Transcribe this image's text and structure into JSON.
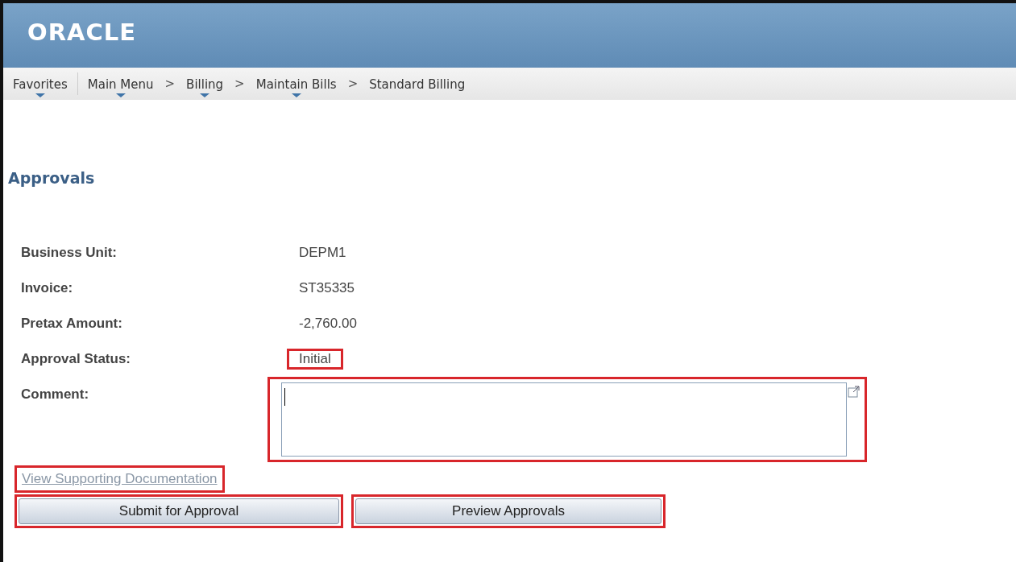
{
  "header": {
    "logo": "ORACLE"
  },
  "breadcrumbs": [
    {
      "kind": "link",
      "label": "Favorites",
      "menu": true
    },
    {
      "kind": "divider"
    },
    {
      "kind": "link",
      "label": "Main Menu",
      "menu": true
    },
    {
      "kind": "separator",
      "label": ">"
    },
    {
      "kind": "link",
      "label": "Billing",
      "menu": true
    },
    {
      "kind": "separator",
      "label": ">"
    },
    {
      "kind": "link",
      "label": "Maintain Bills",
      "menu": true
    },
    {
      "kind": "separator",
      "label": ">"
    },
    {
      "kind": "link",
      "label": "Standard Billing",
      "menu": false
    }
  ],
  "page_title": "Approvals",
  "fields": [
    {
      "label": "Business Unit:",
      "value": "DEPM1",
      "highlighted": false
    },
    {
      "label": "Invoice:",
      "value": "ST35335",
      "highlighted": false
    },
    {
      "label": "Pretax Amount:",
      "value": "-2,760.00",
      "highlighted": false
    },
    {
      "label": "Approval Status:",
      "value": "Initial",
      "highlighted": true
    }
  ],
  "comment": {
    "label": "Comment:",
    "highlighted": true
  },
  "link": {
    "label": "View Supporting Documentation",
    "highlighted": true
  },
  "buttons": [
    {
      "label": "Submit for Approval",
      "highlighted": true
    },
    {
      "label": "Preview Approvals",
      "highlighted": true
    }
  ]
}
